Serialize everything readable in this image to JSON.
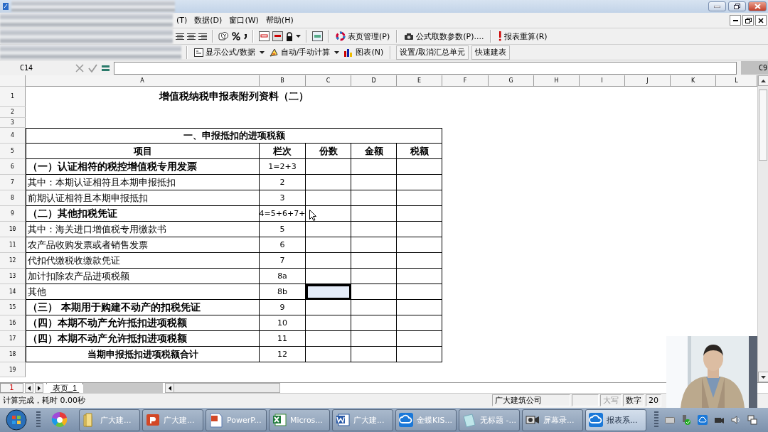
{
  "menu_bar": {
    "items": [
      "(T)",
      "数据(D)",
      "窗口(W)",
      "帮助(H)"
    ]
  },
  "toolbar_1": {
    "items": [
      "表页管理(P)",
      "公式取数参数(P)....",
      "报表重算(R)"
    ]
  },
  "toolbar_2": {
    "items": [
      {
        "label": "显示公式/数据",
        "kind": "dropdown"
      },
      {
        "label": "自动/手动计算",
        "kind": "dropdown"
      },
      {
        "label": "图表(N)",
        "kind": "plain"
      },
      {
        "label": "设置/取消汇总单元",
        "kind": "boxed"
      },
      {
        "label": "快速建表",
        "kind": "boxed"
      }
    ]
  },
  "formula_bar": {
    "cell": "C14",
    "sheet_ref": "C9"
  },
  "sheet": {
    "columns": [
      "A",
      "B",
      "C",
      "D",
      "E",
      "F",
      "G",
      "H",
      "I",
      "J",
      "K",
      "L"
    ],
    "row_numbers": [
      "1",
      "2",
      "3",
      "4",
      "5",
      "6",
      "7",
      "8",
      "9",
      "10",
      "11",
      "12",
      "13",
      "14",
      "15",
      "16",
      "17",
      "18",
      "19"
    ],
    "title": "增值税纳税申报表附列资料（二）",
    "section_heading": "一、申报抵扣的进项税额",
    "header": [
      "项目",
      "栏次",
      "份数",
      "金额",
      "税额"
    ],
    "rows": [
      {
        "kind": "bold",
        "item": "（一）认证相符的税控增值税专用发票",
        "line": "1=2+3",
        "selected": false
      },
      {
        "kind": "normal",
        "item": "其中：本期认证相符且本期申报抵扣",
        "line": "2",
        "selected": false
      },
      {
        "kind": "normal",
        "item": "前期认证相符且本期申报抵扣",
        "line": "3",
        "selected": false
      },
      {
        "kind": "bold",
        "item": "（二）其他扣税凭证",
        "line": "4=5+6+7+",
        "selected": false
      },
      {
        "kind": "normal",
        "item": "其中：海关进口增值税专用缴款书",
        "line": "5",
        "selected": false
      },
      {
        "kind": "normal",
        "item": "农产品收购发票或者销售发票",
        "line": "6",
        "selected": false
      },
      {
        "kind": "normal",
        "item": "代扣代缴税收缴款凭证",
        "line": "7",
        "selected": false
      },
      {
        "kind": "normal",
        "item": "加计扣除农产品进项税额",
        "line": "8a",
        "selected": false
      },
      {
        "kind": "normal",
        "item": "其他",
        "line": "8b",
        "selected": true
      },
      {
        "kind": "bold",
        "item": "（三）  本期用于购建不动产的扣税凭证",
        "line": "9",
        "selected": false
      },
      {
        "kind": "bold",
        "item": "（四）本期不动产允许抵扣进项税额",
        "line": "10",
        "selected": false
      },
      {
        "kind": "bold",
        "item": "（四）本期不动产允许抵扣进项税额",
        "line": "11",
        "selected": false
      },
      {
        "kind": "total",
        "item": "当期申报抵扣进项税额合计",
        "line": "12",
        "selected": false
      }
    ]
  },
  "sheet_tabs": {
    "page": "1",
    "tabs": [
      {
        "label": "表页_1",
        "selected": true
      }
    ]
  },
  "status_bar": {
    "message": "计算完成，耗时 0.00秒",
    "company": "广大建筑公司",
    "indicators": [
      {
        "label": "大写",
        "on": false
      },
      {
        "label": "数字",
        "on": true
      },
      {
        "label": "20",
        "on": true
      }
    ]
  },
  "taskbar": {
    "items": [
      {
        "label": "广大建...",
        "selected": false
      },
      {
        "label": "广大建...",
        "selected": false
      },
      {
        "label": "PowerP...",
        "selected": false
      },
      {
        "label": "Micros...",
        "selected": false
      },
      {
        "label": "广大建...",
        "selected": false
      },
      {
        "label": "金蝶KIS...",
        "selected": false
      },
      {
        "label": "无标题 -...",
        "selected": false
      },
      {
        "label": "屏幕录...",
        "selected": false
      },
      {
        "label": "报表系...",
        "selected": true
      }
    ]
  }
}
